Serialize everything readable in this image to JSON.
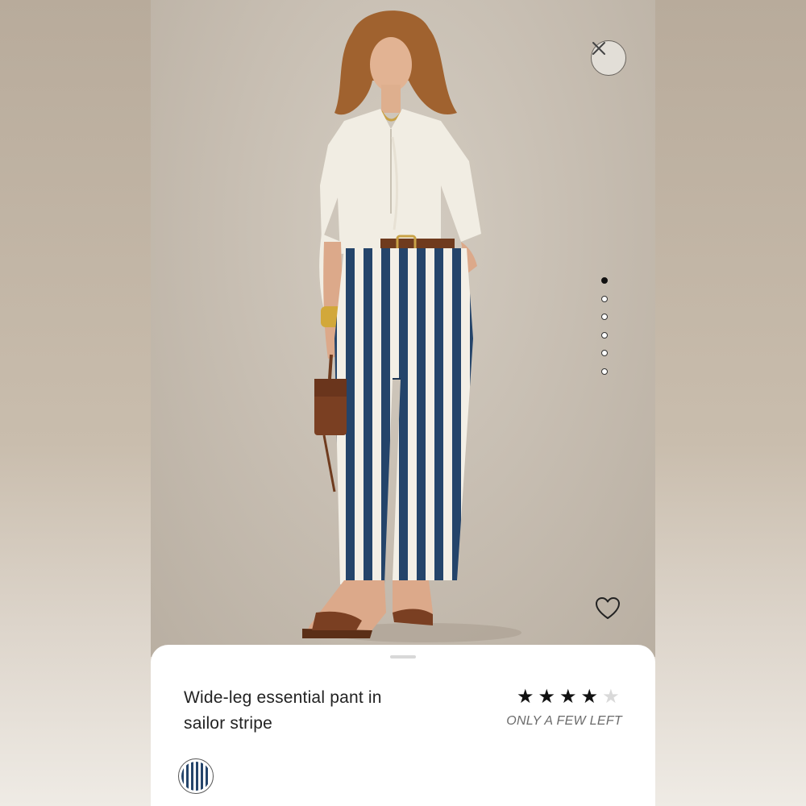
{
  "product": {
    "title": "Wide-leg essential pant in sailor stripe",
    "rating": 4,
    "rating_max": 5,
    "stock_status": "ONLY A FEW LEFT"
  },
  "gallery": {
    "image_count": 6,
    "active_index": 0
  },
  "icons": {
    "close": "close-icon",
    "favorite": "heart-icon",
    "swatch": "sailor-stripe-swatch"
  },
  "colors": {
    "stripe_navy": "#24446a",
    "stripe_ivory": "#f3efe6",
    "shirt": "#f1ede3",
    "leather": "#7a3f22"
  }
}
